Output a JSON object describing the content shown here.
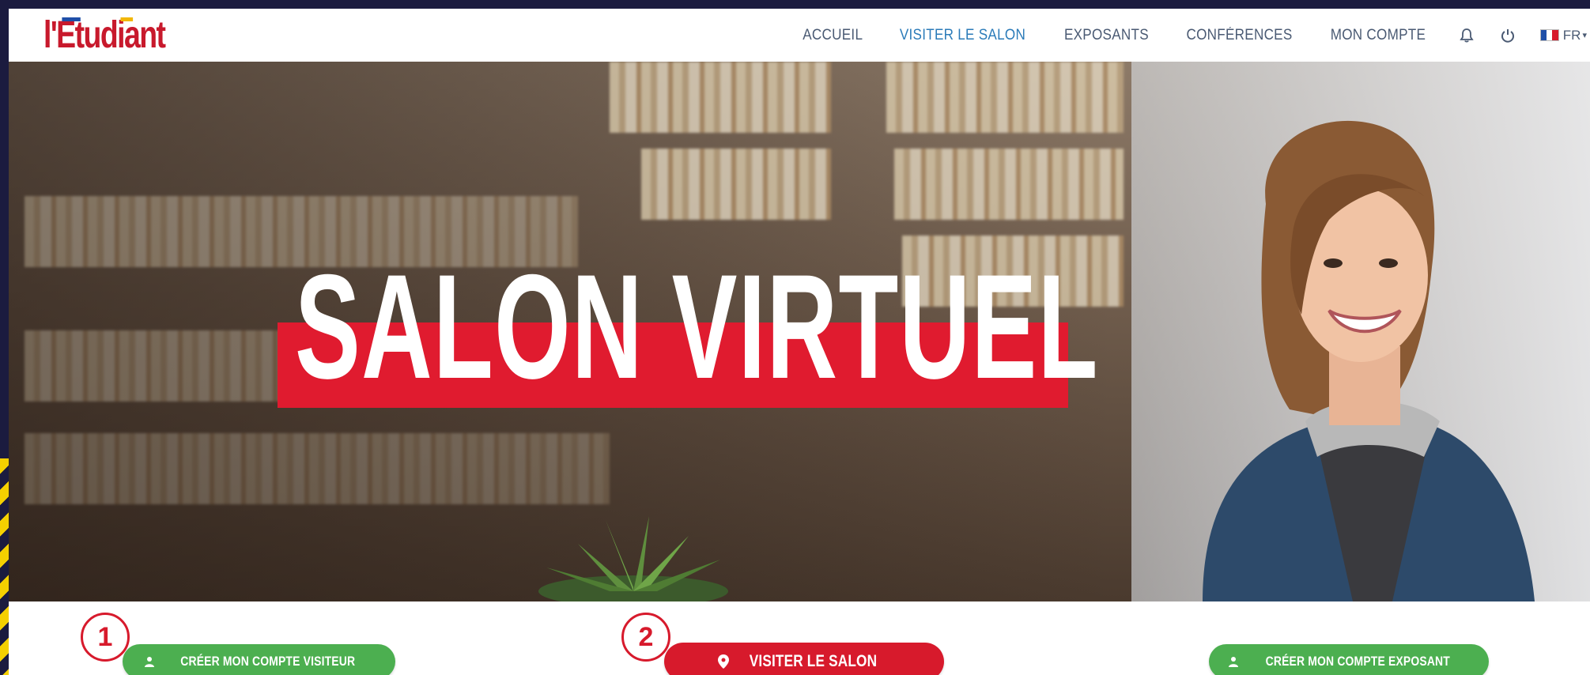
{
  "brand": {
    "logo_text": "l'Etudiant",
    "accent": "#c8192c"
  },
  "nav": {
    "items": [
      {
        "label": "ACCUEIL",
        "active": false
      },
      {
        "label": "VISITER LE SALON",
        "active": true
      },
      {
        "label": "EXPOSANTS",
        "active": false
      },
      {
        "label": "CONFÉRENCES",
        "active": false
      },
      {
        "label": "MON COMPTE",
        "active": false
      }
    ],
    "icons": [
      "bell-icon",
      "power-icon"
    ],
    "language": "FR",
    "active_color": "#2b7bb9"
  },
  "hero": {
    "title": "SALON VIRTUEL",
    "band_color": "#e01b2f"
  },
  "actions": {
    "visitor_button": "CRÉER MON COMPTE VISITEUR",
    "visit_button": "VISITER LE SALON",
    "exhibitor_button": "CRÉER MON COMPTE EXPOSANT",
    "step1": "1",
    "step2": "2",
    "green": "#4caf50",
    "red": "#d71a2c"
  }
}
